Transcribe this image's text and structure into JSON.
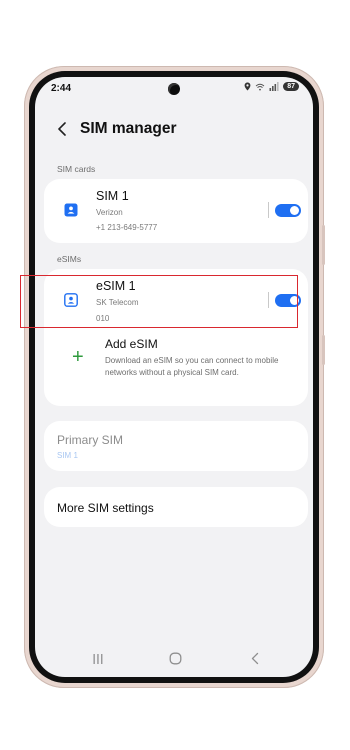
{
  "status_bar": {
    "time": "2:44",
    "battery": "87",
    "icons": [
      "location-icon",
      "wifi-icon",
      "signal-icon",
      "battery-icon"
    ]
  },
  "header": {
    "title": "SIM manager",
    "back_icon": "chevron-left-icon"
  },
  "sections": {
    "sim_cards_label": "SIM cards",
    "esims_label": "eSIMs"
  },
  "sim_cards": [
    {
      "name": "SIM 1",
      "carrier": "Verizon",
      "number": "+1 213-649-5777",
      "enabled": true,
      "icon": "sim-card-icon"
    }
  ],
  "esims": [
    {
      "name": "eSIM 1",
      "carrier": "SK Telecom",
      "number": "010",
      "enabled": true,
      "icon": "esim-contact-icon"
    }
  ],
  "add_esim": {
    "title": "Add eSIM",
    "description": "Download an eSIM so you can connect to mobile networks without a physical SIM card.",
    "icon": "plus-icon"
  },
  "primary_sim": {
    "title": "Primary SIM",
    "value": "SIM 1"
  },
  "more_settings": {
    "label": "More SIM settings"
  },
  "nav_bar": {
    "recents_icon": "recents-icon",
    "home_icon": "home-icon",
    "back_icon": "back-icon"
  },
  "colors": {
    "accent": "#1f6ff2",
    "add_icon": "#2e9a3c",
    "highlight": "#d9282f",
    "screen_bg": "#f2f2f4"
  }
}
